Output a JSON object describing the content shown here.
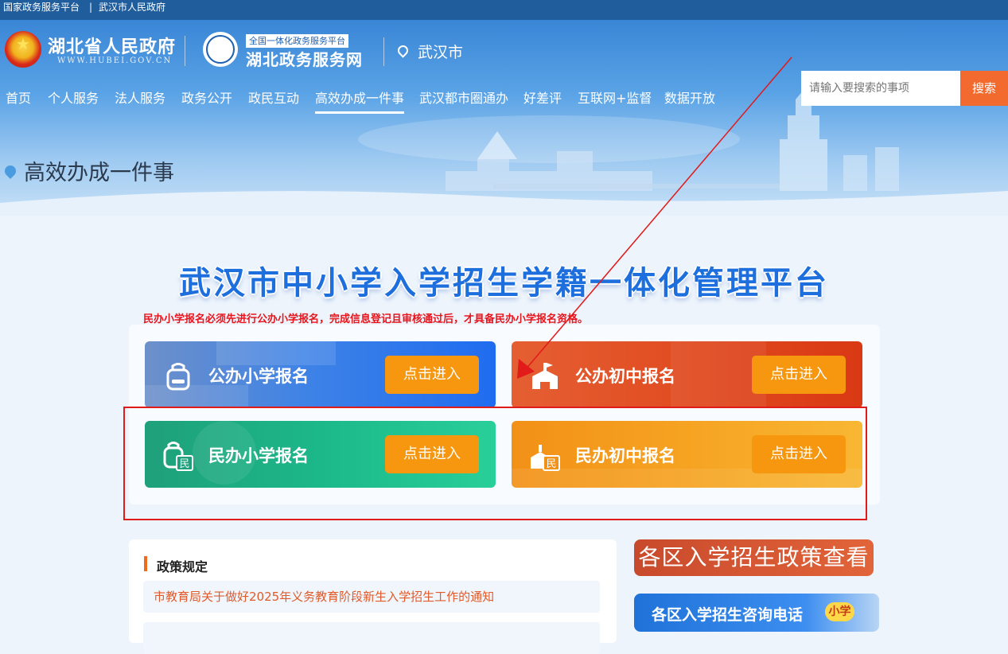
{
  "topbar": {
    "platform_link": "国家政务服务平台",
    "separator": "|",
    "city_link": "武汉市人民政府"
  },
  "header": {
    "site_name": "湖北省人民政府",
    "site_url": "WWW.HUBEI.GOV.CN",
    "service_tag": "全国一体化政务服务平台",
    "service_name": "湖北政务服务网",
    "location": "武汉市",
    "nav": [
      "首页",
      "个人服务",
      "法人服务",
      "政务公开",
      "政民互动",
      "高效办成一件事",
      "武汉都市圈通办",
      "好差评",
      "互联网+监督",
      "数据开放"
    ],
    "active_nav_index": 5,
    "search": {
      "placeholder": "请输入要搜索的事项",
      "button": "搜索"
    },
    "page_title": "高效办成一件事"
  },
  "main": {
    "title": "武汉市中小学入学招生学籍一体化管理平台",
    "notice": "民办小学报名必须先进行公办小学报名，完成信息登记且审核通过后，才具备民办小学报名资格。",
    "cards": [
      {
        "label": "公办小学报名",
        "button": "点击进入",
        "icon": "school-bag-icon",
        "color": "#1f6cf0"
      },
      {
        "label": "公办初中报名",
        "button": "点击进入",
        "icon": "school-building-icon",
        "color": "#e04a1f"
      },
      {
        "label": "民办小学报名",
        "button": "点击进入",
        "icon": "school-bag-private-icon",
        "color": "#1cb88a"
      },
      {
        "label": "民办初中报名",
        "button": "点击进入",
        "icon": "school-building-private-icon",
        "color": "#f6a322"
      }
    ],
    "private_badge": "民"
  },
  "policy": {
    "heading": "政策规定",
    "items": [
      "市教育局关于做好2025年义务教育阶段新生入学招生工作的通知",
      ""
    ]
  },
  "side": {
    "policy_button": "各区入学招生政策查看",
    "phone_button": "各区入学招生咨询电话",
    "phone_tag": "小学"
  },
  "colors": {
    "accent_red": "#e11a1a",
    "header_blue": "#1f5d9c",
    "search_orange": "#f26a2d"
  }
}
